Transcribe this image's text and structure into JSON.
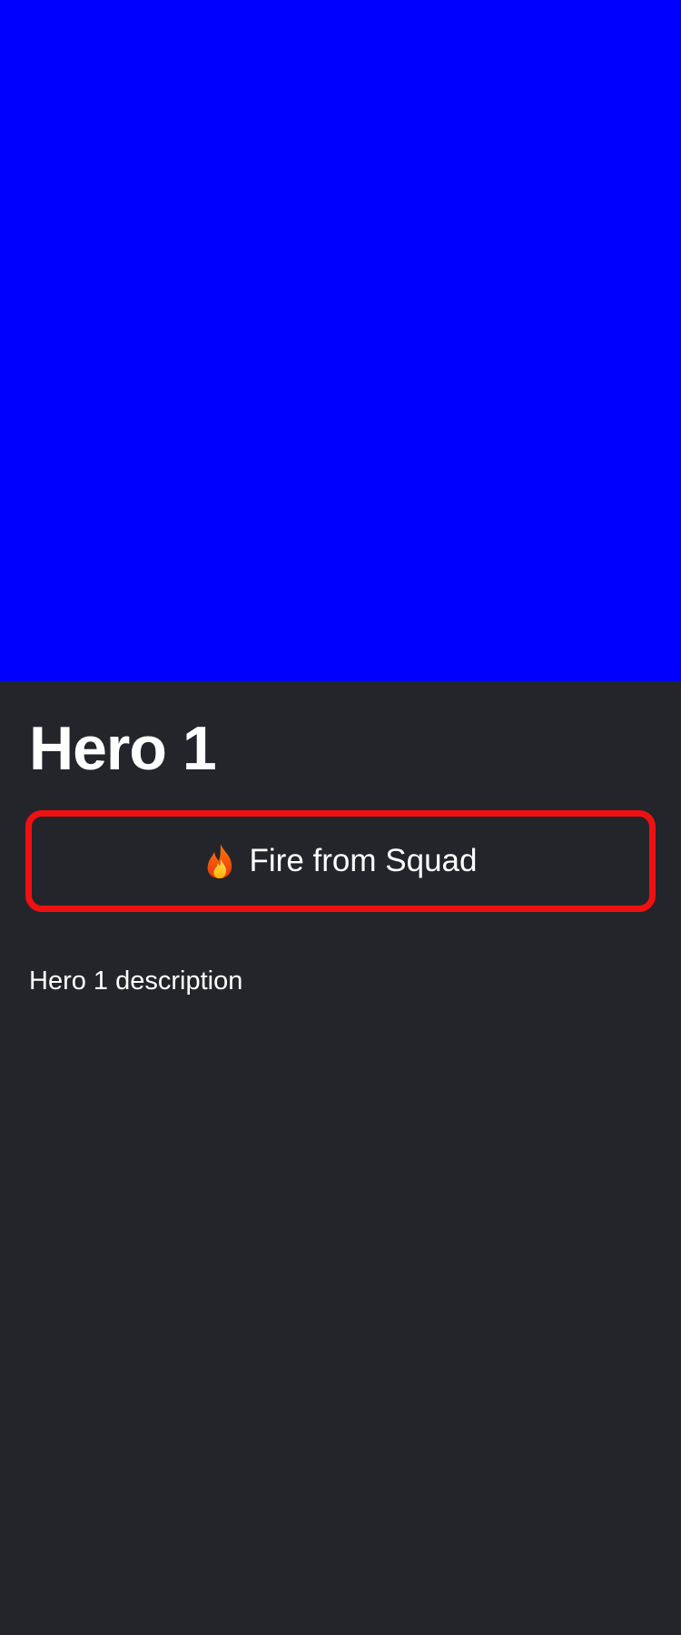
{
  "hero": {
    "image_color": "#0000ff",
    "title": "Hero 1",
    "description": "Hero 1 description"
  },
  "action": {
    "icon": "fire-icon",
    "label": "Fire from Squad",
    "border_color": "#ef1111"
  },
  "theme": {
    "background": "#23252b",
    "text": "#ffffff"
  }
}
